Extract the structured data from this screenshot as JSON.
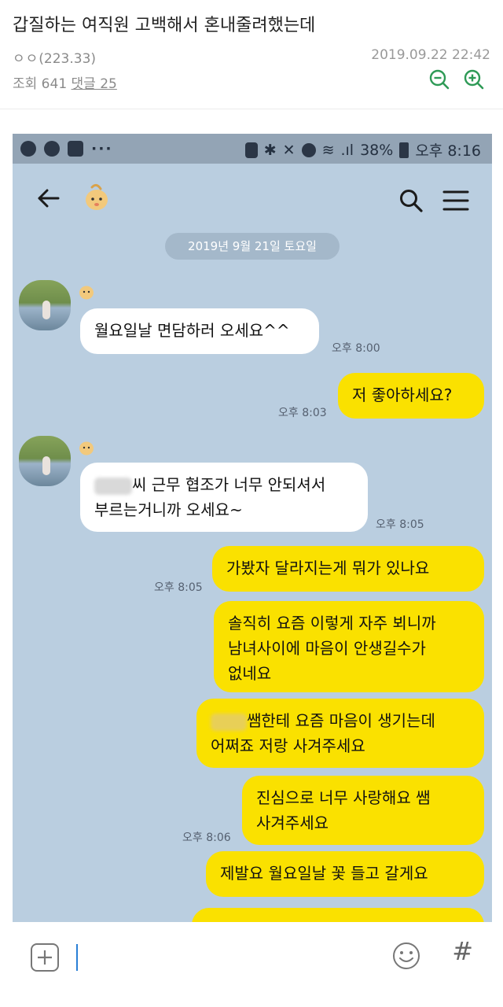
{
  "post": {
    "title": "갑질하는 여직원 고백해서  혼내줄려했는데",
    "author": "ㅇㅇ",
    "author_ip": "(223.33)",
    "datetime": "2019.09.22 22:42",
    "views_label": "조회 641",
    "comments_label": "댓글 25"
  },
  "screenshot": {
    "status_bar": {
      "battery": "38%",
      "clock": "오후 8:16"
    },
    "date_divider": "2019년 9월 21일 토요일",
    "messages": [
      {
        "side": "in",
        "text": "월요일날 면담하러 오세요^^",
        "time": "오후 8:00"
      },
      {
        "side": "out",
        "text": "저 좋아하세요?",
        "time": "오후 8:03"
      },
      {
        "side": "in",
        "line1": "씨 근무 협조가 너무 안되셔서",
        "line2": "부르는거니까 오세요~",
        "time": "오후 8:05"
      },
      {
        "side": "out",
        "text": "가봤자 달라지는게 뭐가 있나요",
        "time": "오후 8:05"
      },
      {
        "side": "out",
        "line1": "솔직히 요즘 이렇게 자주 뵈니까",
        "line2": "남녀사이에 마음이 안생길수가",
        "line3": "없네요"
      },
      {
        "side": "out",
        "line1": "쌤한테 요즘 마음이 생기는데",
        "line2": "어쩌죠 저랑 사겨주세요"
      },
      {
        "side": "out",
        "line1": "진심으로 너무 사랑해요 쌤",
        "line2": "사겨주세요",
        "time": "오후 8:06"
      },
      {
        "side": "out",
        "text": "제발요 월요일날 꽃 들고 갈게요"
      }
    ]
  },
  "colors": {
    "chat_bg": "#bacee0",
    "my_bubble": "#fae100",
    "their_bubble": "#ffffff",
    "zoom_icon": "#2e9a56"
  }
}
